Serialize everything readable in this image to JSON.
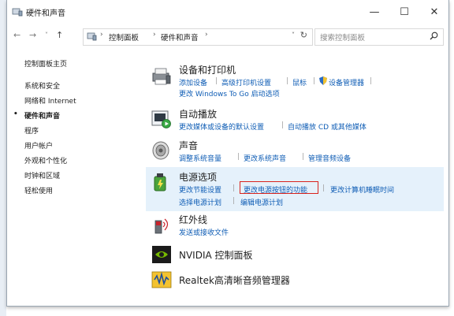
{
  "window": {
    "title": "硬件和声音",
    "controls": {
      "minimize": "—",
      "maximize": "☐",
      "close": "✕"
    }
  },
  "address": {
    "back": "←",
    "forward": "→",
    "recent": "˅",
    "up": "↑",
    "crumb_sep": "›",
    "crumbs": [
      "控制面板",
      "硬件和声音"
    ],
    "dropdown": "˅",
    "refresh": "↻",
    "search_placeholder": "搜索控制面板"
  },
  "sidebar": {
    "bullet": "•",
    "items": [
      {
        "label": "控制面板主页"
      },
      {
        "label": "系统和安全"
      },
      {
        "label": "网络和 Internet"
      },
      {
        "label": "硬件和声音",
        "active": true
      },
      {
        "label": "程序"
      },
      {
        "label": "用户帐户"
      },
      {
        "label": "外观和个性化"
      },
      {
        "label": "时钟和区域"
      },
      {
        "label": "轻松使用"
      }
    ]
  },
  "categories": {
    "devices": {
      "title": "设备和打印机",
      "links": [
        "添加设备",
        "高级打印机设置",
        "鼠标",
        "设备管理器",
        "更改 Windows To Go 启动选项"
      ]
    },
    "autoplay": {
      "title": "自动播放",
      "links": [
        "更改媒体或设备的默认设置",
        "自动播放 CD 或其他媒体"
      ]
    },
    "sound": {
      "title": "声音",
      "links": [
        "调整系统音量",
        "更改系统声音",
        "管理音频设备"
      ]
    },
    "power": {
      "title": "电源选项",
      "links": [
        "更改节能设置",
        "更改电源按钮的功能",
        "更改计算机睡眠时间",
        "选择电源计划",
        "编辑电源计划"
      ]
    },
    "infrared": {
      "title": "红外线",
      "links": [
        "发送或接收文件"
      ]
    },
    "nvidia": {
      "title": "NVIDIA 控制面板"
    },
    "realtek": {
      "title": "Realtek高清晰音频管理器"
    }
  },
  "colors": {
    "link": "#0f5db5",
    "highlight_bg": "#e5f1fb",
    "annotation_red": "#d9231d"
  }
}
